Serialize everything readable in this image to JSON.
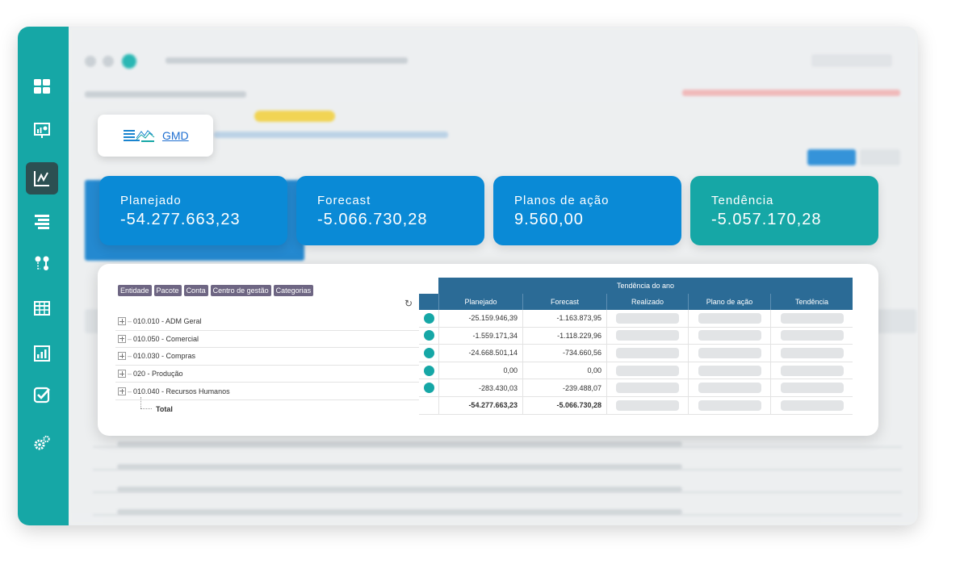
{
  "logo": {
    "text": "GMD"
  },
  "kpis": [
    {
      "label": "Planejado",
      "value": "-54.277.663,23",
      "color": "#0a8ad6"
    },
    {
      "label": "Forecast",
      "value": "-5.066.730,28",
      "color": "#0a8ad6"
    },
    {
      "label": "Planos de ação",
      "value": "9.560,00",
      "color": "#0a8ad6"
    },
    {
      "label": "Tendência",
      "value": "-5.057.170,28",
      "color": "#16a7a6"
    }
  ],
  "filters": [
    "Entidade",
    "Pacote",
    "Conta",
    "Centro de gestão",
    "Categorias"
  ],
  "grid": {
    "title": "Tendência do ano",
    "columns": [
      "Planejado",
      "Forecast",
      "Realizado",
      "Plano de ação",
      "Tendência"
    ],
    "rows": [
      {
        "label": "010.010 - ADM Geral",
        "planejado": "-25.159.946,39",
        "forecast": "-1.163.873,95"
      },
      {
        "label": "010.050 - Comercial",
        "planejado": "-1.559.171,34",
        "forecast": "-1.118.229,96"
      },
      {
        "label": "010.030 - Compras",
        "planejado": "-24.668.501,14",
        "forecast": "-734.660,56"
      },
      {
        "label": "020 - Produção",
        "planejado": "0,00",
        "forecast": "0,00"
      },
      {
        "label": "010.040 - Recursos Humanos",
        "planejado": "-283.430,03",
        "forecast": "-239.488,07"
      }
    ],
    "total": {
      "label": "Total",
      "planejado": "-54.277.663,23",
      "forecast": "-5.066.730,28"
    }
  },
  "sidebar": {
    "icons": [
      "dashboard-icon",
      "presentation-icon",
      "line-chart-icon",
      "list-icon",
      "workflow-icon",
      "table-icon",
      "bar-chart-icon",
      "checklist-icon",
      "settings-icon"
    ],
    "active": "line-chart-icon",
    "color": "#16a7a6"
  }
}
